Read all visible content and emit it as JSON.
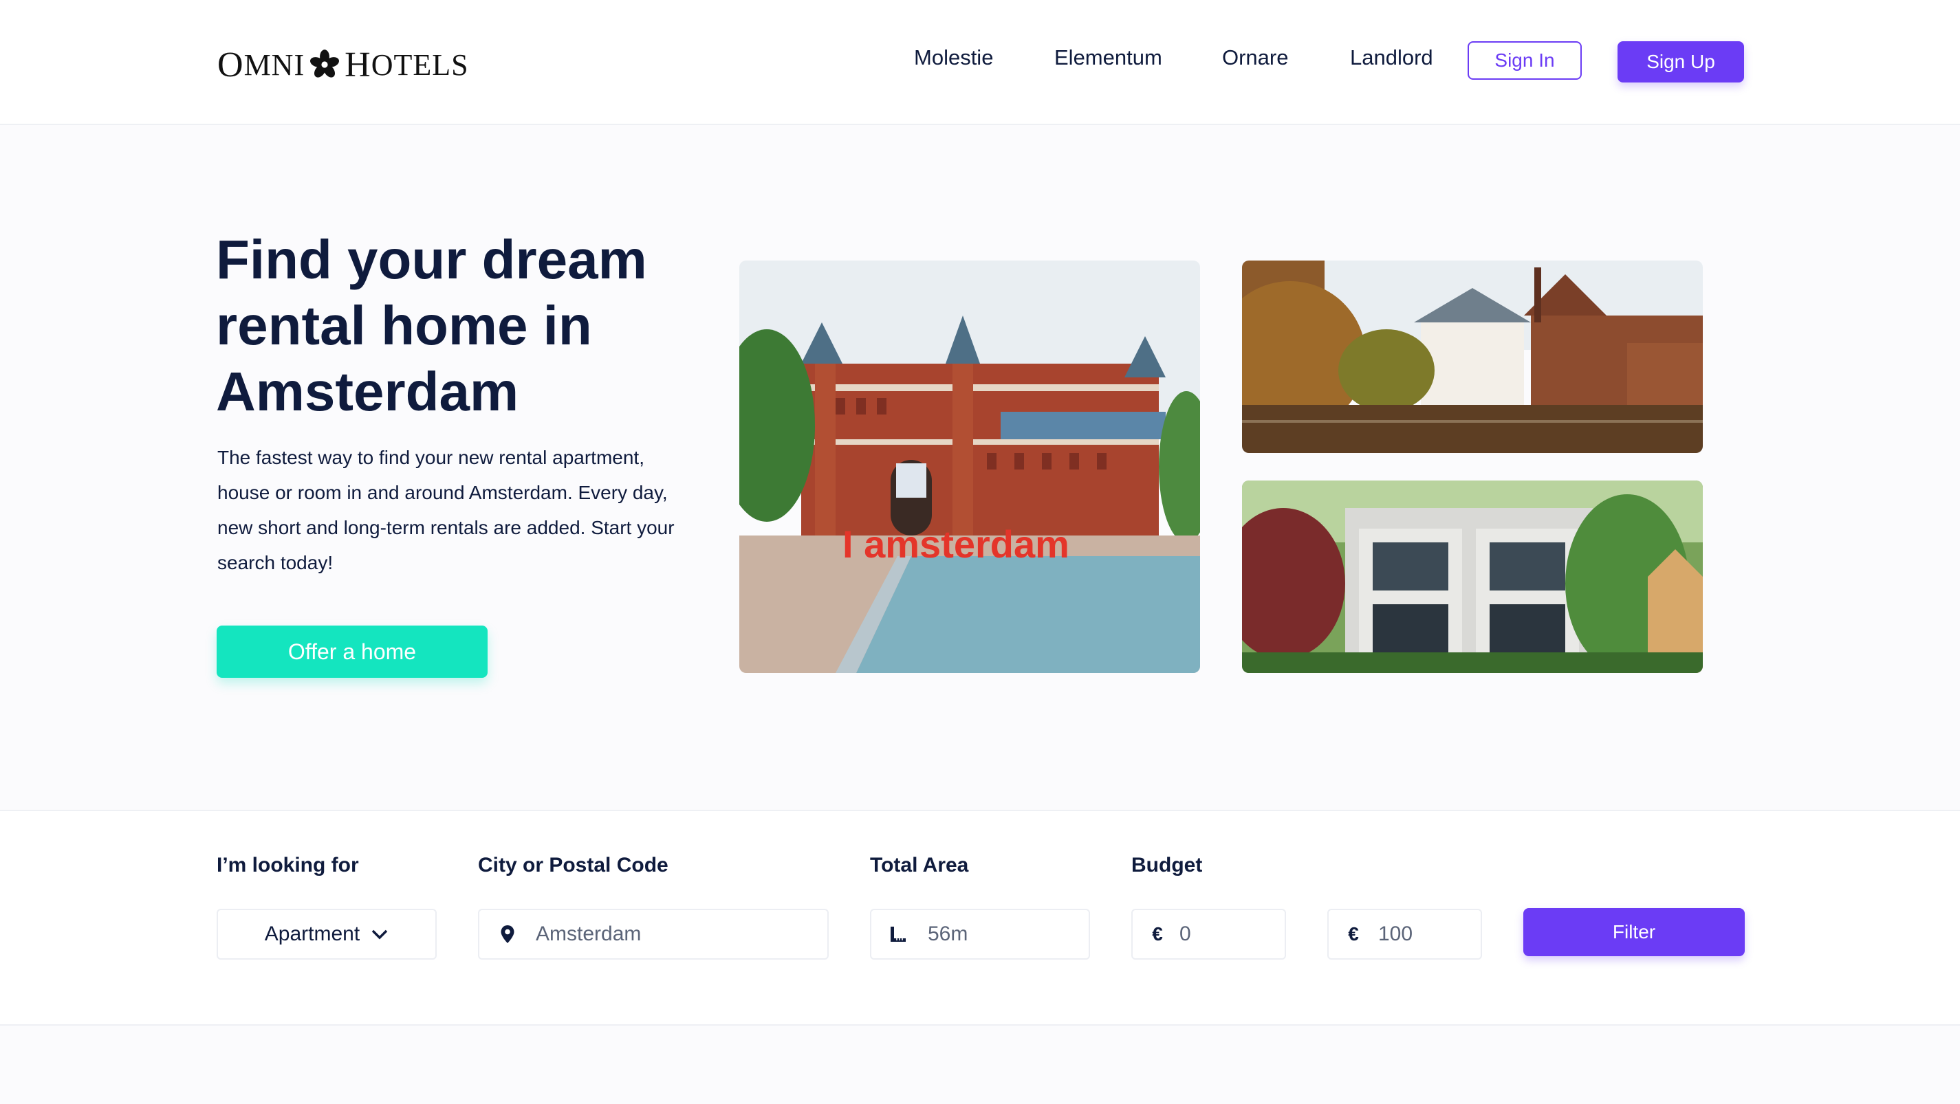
{
  "header": {
    "logo": {
      "word1_big": "O",
      "word1_rest": "MNI",
      "word2_big": "H",
      "word2_rest": "OTELS"
    },
    "nav": [
      "Molestie",
      "Elementum",
      "Ornare",
      "Landlord"
    ],
    "sign_in": "Sign In",
    "sign_up": "Sign Up"
  },
  "hero": {
    "title_lines": [
      "Find your dream",
      "rental home in",
      "Amsterdam"
    ],
    "description_lines": [
      "The fastest way to find your new rental apartment,",
      "house or room in and around Amsterdam. Every day,",
      "new short and long-term rentals are added. Start your",
      "search today!"
    ],
    "cta": "Offer a home",
    "photo_sign_text": "I amsterdam"
  },
  "search": {
    "looking_for_label": "I’m looking for",
    "looking_for_value": "Apartment",
    "city_label": "City or Postal Code",
    "city_placeholder": "Amsterdam",
    "area_label": "Total Area",
    "area_placeholder": "56m",
    "budget_label": "Budget",
    "budget_min": "0",
    "budget_max": "100",
    "currency": "€",
    "filter": "Filter"
  },
  "colors": {
    "brand_purple": "#6b3cf5",
    "cta_teal": "#14e5bf",
    "text_navy": "#0f1b3d"
  },
  "icons": [
    "flower-logo-icon",
    "location-pin-icon",
    "ruler-icon",
    "euro-icon",
    "chevron-down-icon"
  ]
}
